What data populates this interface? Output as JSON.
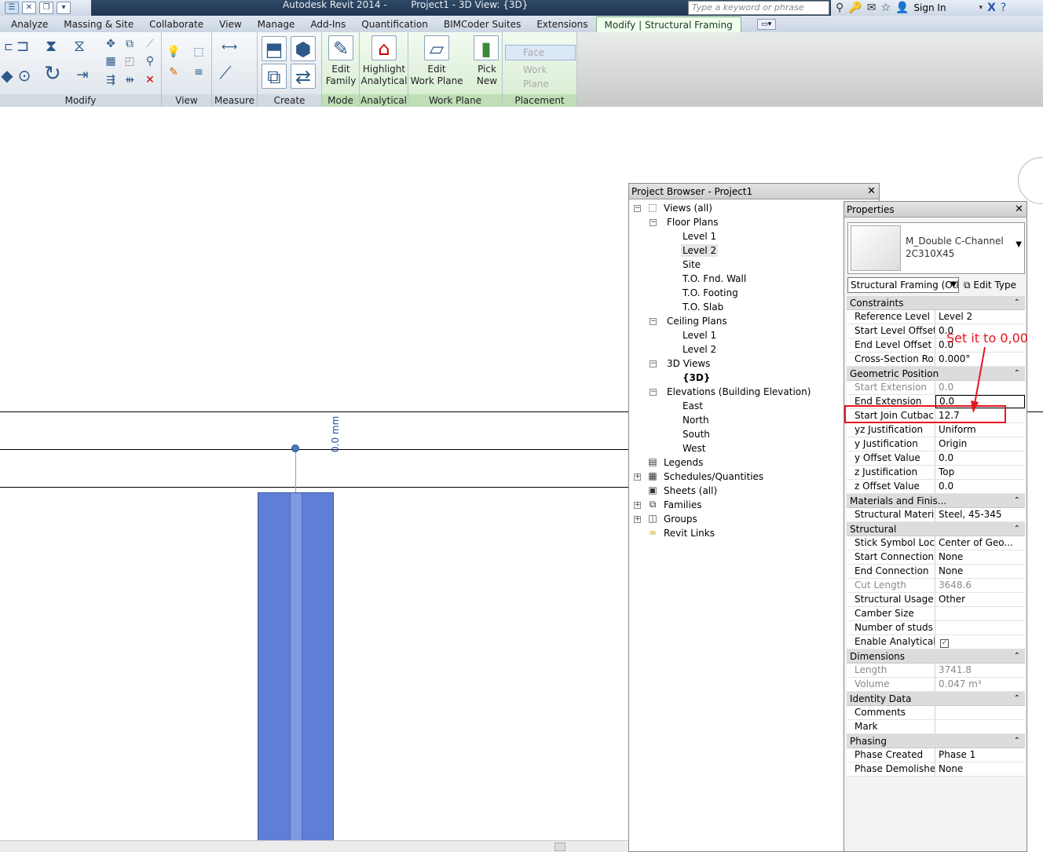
{
  "window": {
    "app_title": "Autodesk Revit 2014 -",
    "doc_title": "Project1 - 3D View: {3D}",
    "search_placeholder": "Type a keyword or phrase",
    "sign_in": "Sign In"
  },
  "tabs": [
    {
      "label": "Analyze"
    },
    {
      "label": "Massing & Site"
    },
    {
      "label": "Collaborate"
    },
    {
      "label": "View"
    },
    {
      "label": "Manage"
    },
    {
      "label": "Add-Ins"
    },
    {
      "label": "Quantification"
    },
    {
      "label": "BIMCoder Suites"
    },
    {
      "label": "Extensions"
    },
    {
      "label": "Modify | Structural Framing"
    }
  ],
  "ribbon": {
    "panels": {
      "modify": "Modify",
      "view": "View",
      "measure": "Measure",
      "create": "Create",
      "mode": "Mode",
      "analytical": "Analytical",
      "work_plane": "Work Plane",
      "placement": "Placement"
    },
    "buttons": {
      "edit_family_1": "Edit",
      "edit_family_2": "Family",
      "highlight_1": "Highlight",
      "highlight_2": "Analytical",
      "edit_wp_1": "Edit",
      "edit_wp_2": "Work Plane",
      "pick_new_1": "Pick",
      "pick_new_2": "New",
      "face": "Face",
      "work_plane": "Work Plane"
    }
  },
  "canvas": {
    "dimension_text": "0.0 mm"
  },
  "project_browser": {
    "title": "Project Browser - Project1",
    "tree": {
      "views_all": "Views (all)",
      "floor_plans": "Floor Plans",
      "fp_level1": "Level 1",
      "fp_level2": "Level 2",
      "fp_site": "Site",
      "fp_fnd_wall": "T.O. Fnd. Wall",
      "fp_footing": "T.O. Footing",
      "fp_slab": "T.O. Slab",
      "ceiling_plans": "Ceiling Plans",
      "cp_level1": "Level 1",
      "cp_level2": "Level 2",
      "views_3d": "3D Views",
      "view_3d": "{3D}",
      "elevations": "Elevations (Building Elevation)",
      "el_east": "East",
      "el_north": "North",
      "el_south": "South",
      "el_west": "West",
      "legends": "Legends",
      "schedules": "Schedules/Quantities",
      "sheets": "Sheets (all)",
      "families": "Families",
      "groups": "Groups",
      "revit_links": "Revit Links"
    }
  },
  "properties": {
    "title": "Properties",
    "type_name": "M_Double C-Channel",
    "type_size": "2C310X45",
    "filter": "Structural Framing (Otl",
    "edit_type": "Edit Type",
    "groups": {
      "constraints": "Constraints",
      "geometric": "Geometric Position",
      "materials": "Materials and Finis...",
      "structural": "Structural",
      "dimensions": "Dimensions",
      "identity": "Identity Data",
      "phasing": "Phasing"
    },
    "rows": {
      "reference_level": {
        "label": "Reference Level",
        "value": "Level 2"
      },
      "start_level_offset": {
        "label": "Start Level Offset",
        "value": "0.0"
      },
      "end_level_offset": {
        "label": "End Level Offset",
        "value": "0.0"
      },
      "cross_section": {
        "label": "Cross-Section Ro...",
        "value": "0.000°"
      },
      "start_extension": {
        "label": "Start Extension",
        "value": "0.0"
      },
      "end_extension": {
        "label": "End Extension",
        "value": "0.0"
      },
      "start_join_cutback": {
        "label": "Start Join Cutback",
        "value": "12.7"
      },
      "yz_justification": {
        "label": "yz Justification",
        "value": "Uniform"
      },
      "y_justification": {
        "label": "y Justification",
        "value": "Origin"
      },
      "y_offset": {
        "label": "y Offset Value",
        "value": "0.0"
      },
      "z_justification": {
        "label": "z Justification",
        "value": "Top"
      },
      "z_offset": {
        "label": "z Offset Value",
        "value": "0.0"
      },
      "structural_material": {
        "label": "Structural Material",
        "value": "Steel, 45-345"
      },
      "stick_symbol": {
        "label": "Stick Symbol Loc...",
        "value": "Center of Geo..."
      },
      "start_connection": {
        "label": "Start Connection",
        "value": "None"
      },
      "end_connection": {
        "label": "End Connection",
        "value": "None"
      },
      "cut_length": {
        "label": "Cut Length",
        "value": "3648.6"
      },
      "structural_usage": {
        "label": "Structural Usage",
        "value": "Other"
      },
      "camber_size": {
        "label": "Camber Size",
        "value": ""
      },
      "number_of_studs": {
        "label": "Number of studs",
        "value": ""
      },
      "enable_analytical": {
        "label": "Enable Analytical...",
        "value": "✓"
      },
      "length": {
        "label": "Length",
        "value": "3741.8"
      },
      "volume": {
        "label": "Volume",
        "value": "0.047 m³"
      },
      "comments": {
        "label": "Comments",
        "value": ""
      },
      "mark": {
        "label": "Mark",
        "value": ""
      },
      "phase_created": {
        "label": "Phase Created",
        "value": "Phase 1"
      },
      "phase_demolished": {
        "label": "Phase Demolished",
        "value": "None"
      }
    }
  },
  "annotation": {
    "text": "Set it to 0,00",
    "color": "#e8141e"
  },
  "colors": {
    "beam": "#5f7fd6",
    "active_tab": "#f0fff0"
  }
}
